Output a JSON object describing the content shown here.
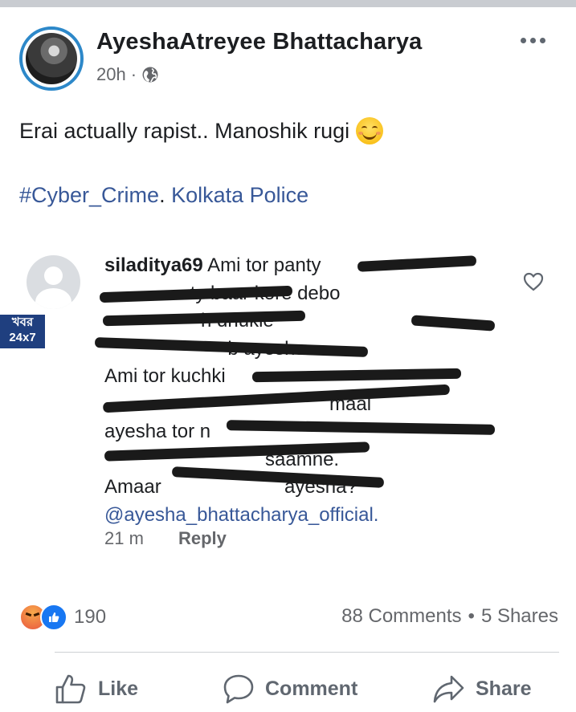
{
  "post": {
    "author": "AyeshaAtreyee Bhattacharya",
    "time": "20h",
    "separator": "·",
    "privacy_icon": "globe-icon",
    "text": "Erai actually rapist.. Manoshik rugi",
    "emoji": "smiling-face-icon",
    "hashtag": "#Cyber_Crime",
    "hashtag_sep": ".",
    "mention": "Kolkata Police"
  },
  "comment": {
    "username": "siladitya69",
    "lines": [
      " Ami tor panty",
      "                ty baar kore debo",
      "                  h dhukie ",
      "                       b ayesha.",
      "Ami tor kuchki ",
      "                                          maal",
      "ayesha tor n",
      "                              saamne.",
      "Amaar                       ayesha?"
    ],
    "mention": "@ayesha_bhattacharya_official.",
    "time": "21 m",
    "reply_label": "Reply",
    "like_icon": "heart-outline-icon"
  },
  "watermark": {
    "line1": "খবর",
    "line2": "24x7"
  },
  "reactions": {
    "icons": [
      "angry-reaction-icon",
      "like-reaction-icon"
    ],
    "count": "190",
    "comments": "88 Comments",
    "separator": "•",
    "shares": "5 Shares"
  },
  "actions": {
    "like": "Like",
    "comment": "Comment",
    "share": "Share"
  },
  "colors": {
    "link": "#385898",
    "avatar_ring": "#2d88c9",
    "like_blue": "#1877f2",
    "muted": "#65676b"
  }
}
